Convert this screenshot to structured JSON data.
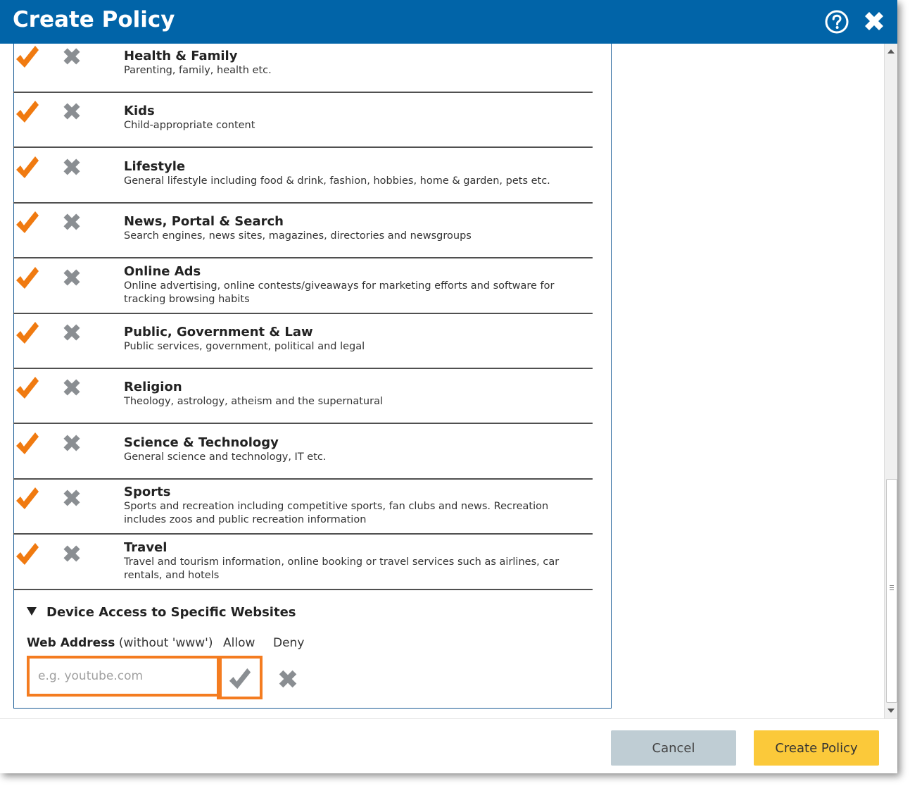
{
  "dialog": {
    "title": "Create Policy",
    "help_icon": "question-circle-icon",
    "close_icon": "close-icon"
  },
  "categories": [
    {
      "name": "Health & Family",
      "description": "Parenting, family, health etc."
    },
    {
      "name": "Kids",
      "description": "Child-appropriate content"
    },
    {
      "name": "Lifestyle",
      "description": "General lifestyle including food & drink, fashion, hobbies, home & garden, pets etc."
    },
    {
      "name": "News, Portal & Search",
      "description": "Search engines, news sites, magazines, directories and newsgroups"
    },
    {
      "name": "Online Ads",
      "description": "Online advertising, online contests/giveaways for marketing efforts and software for tracking browsing habits"
    },
    {
      "name": "Public, Government & Law",
      "description": "Public services, government, political and legal"
    },
    {
      "name": "Religion",
      "description": "Theology, astrology, atheism and the supernatural"
    },
    {
      "name": "Science & Technology",
      "description": "General science and technology, IT etc."
    },
    {
      "name": "Sports",
      "description": "Sports and recreation including competitive sports, fan clubs and news. Recreation includes zoos and public recreation information"
    },
    {
      "name": "Travel",
      "description": "Travel and tourism information, online booking or travel services such as airlines, car rentals, and hotels"
    }
  ],
  "website_section": {
    "title": "Device Access to Specific Websites",
    "web_address_label": "Web Address",
    "web_address_hint": "(without 'www')",
    "allow_label": "Allow",
    "deny_label": "Deny",
    "input_value": "",
    "input_placeholder": "e.g. youtube.com"
  },
  "footer": {
    "cancel_label": "Cancel",
    "create_label": "Create Policy"
  },
  "colors": {
    "title_bar": "#0164a8",
    "allow_check": "#f07a10",
    "deny_x": "#8a8e92",
    "highlight_border": "#f47c20",
    "create_button": "#fbc93a",
    "cancel_button": "#bfcdd4"
  }
}
